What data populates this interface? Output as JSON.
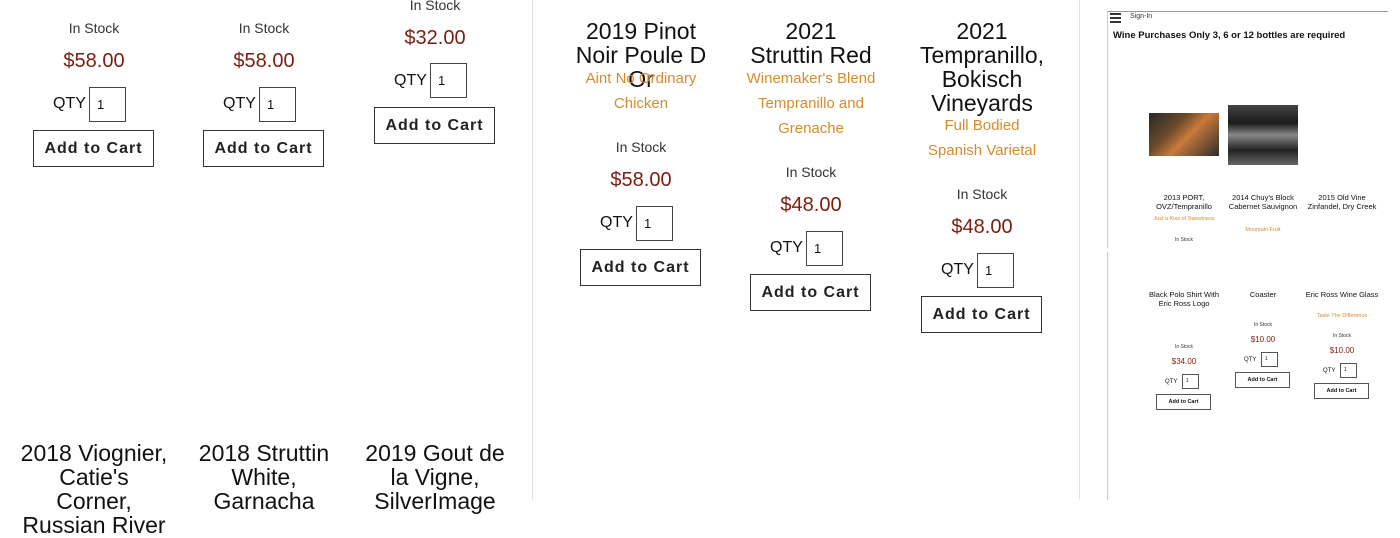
{
  "products_top_left": [
    {
      "stock": "In Stock",
      "price": "$58.00",
      "qty_label": "QTY",
      "qty_value": "1",
      "button": "Add to Cart"
    },
    {
      "stock": "In Stock",
      "price": "$58.00",
      "qty_label": "QTY",
      "qty_value": "1",
      "button": "Add to Cart"
    },
    {
      "stock": "In Stock",
      "price": "$32.00",
      "qty_label": "QTY",
      "qty_value": "1",
      "button": "Add to Cart"
    }
  ],
  "products_top_right": [
    {
      "title": "2019 Pinot Noir Poule D Or",
      "description": "Aint No Ordinary Chicken",
      "stock": "In Stock",
      "price": "$58.00",
      "qty_label": "QTY",
      "qty_value": "1",
      "button": "Add to Cart"
    },
    {
      "title": "2021 Struttin Red",
      "description": "Winemaker's Blend Tempranillo and Grenache",
      "stock": "In Stock",
      "price": "$48.00",
      "qty_label": "QTY",
      "qty_value": "1",
      "button": "Add to Cart"
    },
    {
      "title": "2021 Tempranillo, Bokisch Vineyards",
      "description": "Full Bodied Spanish Varietal",
      "stock": "In Stock",
      "price": "$48.00",
      "qty_label": "QTY",
      "qty_value": "1",
      "button": "Add to Cart"
    }
  ],
  "products_bottom": [
    {
      "title": "2018 Viognier, Catie's Corner, Russian River"
    },
    {
      "title": "2018 Struttin White, Garnacha"
    },
    {
      "title": "2019 Gout de la Vigne, SilverImage"
    }
  ],
  "mini": {
    "sign_in": "Sign-In",
    "notice": "Wine Purchases Only 3, 6 or 12 bottles are required",
    "row1": [
      {
        "title": "2013 PORT, OVZ/Tempranillo",
        "description": "Just a Kiss of Sweetness",
        "stock": "In Stock"
      },
      {
        "title": "2014 Chuy's Block Cabernet Sauvignon",
        "description": "Mountain Fruit"
      },
      {
        "title": "2015 Old Vine Zinfandel, Dry Creek"
      }
    ],
    "row2": [
      {
        "title": "Black Polo Shirt With Eric Ross Logo",
        "stock": "In Stock",
        "price": "$34.00",
        "qty_label": "QTY",
        "qty_value": "1",
        "button": "Add to Cart"
      },
      {
        "title": "Coaster",
        "stock": "In Stock",
        "price": "$10.00",
        "qty_label": "QTY",
        "qty_value": "1",
        "button": "Add to Cart"
      },
      {
        "title": "Eric Ross Wine Glass",
        "description": "Taste The Difference",
        "stock": "In Stock",
        "price": "$10.00",
        "qty_label": "QTY",
        "qty_value": "1",
        "button": "Add to Cart"
      }
    ]
  }
}
